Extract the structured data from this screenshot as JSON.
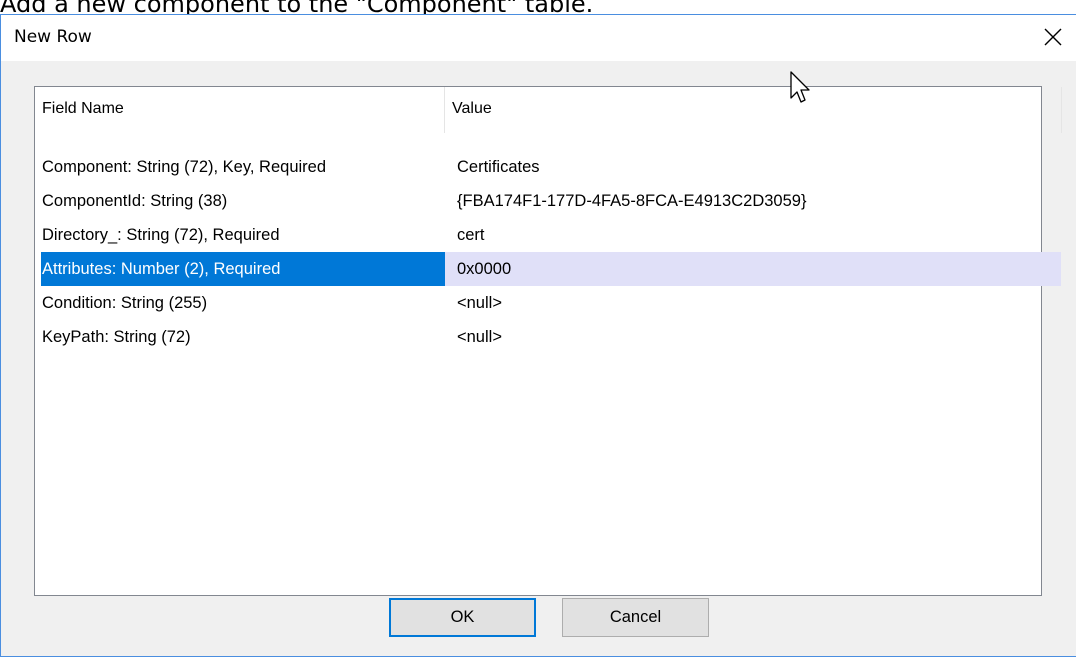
{
  "caption": "Add a new component to the \"Component\" table.",
  "dialog": {
    "title": "New Row",
    "columns": [
      "Field Name",
      "Value"
    ],
    "rows": [
      {
        "field": "Component: String (72), Key, Required",
        "value": "Certificates",
        "selected": false
      },
      {
        "field": "ComponentId: String (38)",
        "value": "{FBA174F1-177D-4FA5-8FCA-E4913C2D3059}",
        "selected": false
      },
      {
        "field": "Directory_: String (72), Required",
        "value": "cert",
        "selected": false
      },
      {
        "field": "Attributes: Number (2), Required",
        "value": "0x0000",
        "selected": true
      },
      {
        "field": "Condition: String (255)",
        "value": "<null>",
        "selected": false
      },
      {
        "field": "KeyPath: String (72)",
        "value": "<null>",
        "selected": false
      }
    ],
    "buttons": {
      "ok": "OK",
      "cancel": "Cancel"
    }
  },
  "colors": {
    "selection": "#0078d7",
    "selection_value": "#e0e0f8",
    "window_border": "#4a8ee0",
    "dialog_bg": "#f0f0f0"
  },
  "icons": {
    "close": "close-icon",
    "cursor": "mouse-pointer-icon"
  }
}
